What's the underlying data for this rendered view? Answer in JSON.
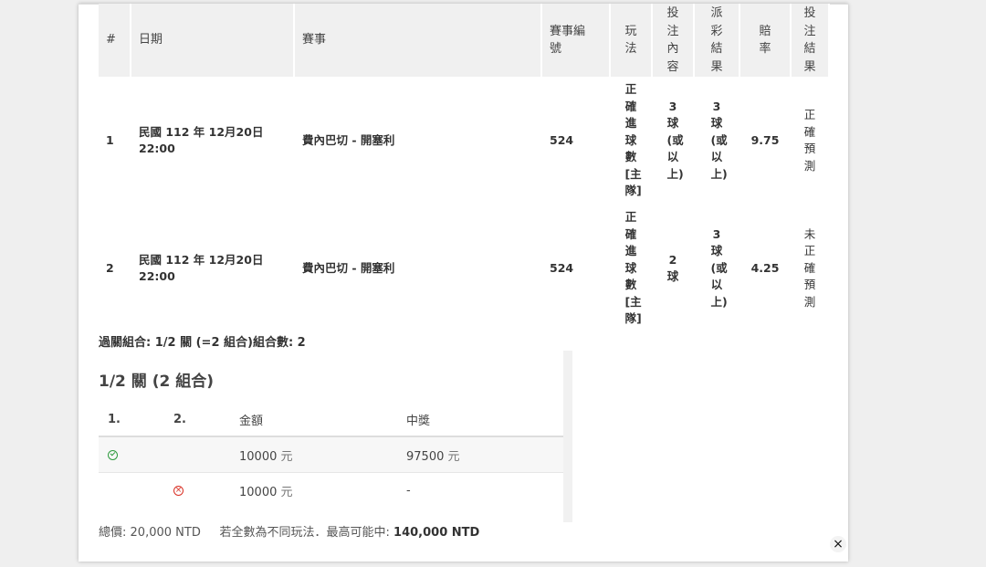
{
  "bets_table": {
    "headers": {
      "num": "#",
      "date": "日期",
      "event": "賽事",
      "event_no": "賽事編號",
      "play": "玩法",
      "selection": "投注內容",
      "result": "派彩結果",
      "odds": "賠率",
      "bet_result": "投注結果"
    },
    "rows": [
      {
        "num": "1",
        "date": "民國 112 年 12月20日",
        "time": "22:00",
        "event": "費內巴切 - 開塞利",
        "event_no": "524",
        "play": "正確進球數[主隊]",
        "selection": "3球(或以上)",
        "result": "3球(或以上)",
        "odds": "9.75",
        "bet_result": "正確預測"
      },
      {
        "num": "2",
        "date": "民國 112 年 12月20日",
        "time": "22:00",
        "event": "費內巴切 - 開塞利",
        "event_no": "524",
        "play": "正確進球數[主隊]",
        "selection": "2球",
        "result": "3球(或以上)",
        "odds": "4.25",
        "bet_result": "未正確預測"
      }
    ]
  },
  "combo_summary": "過關組合: 1/2 關 (=2 組合)組合數: 2",
  "section_title": "1/2 關 (2 組合)",
  "combos_table": {
    "headers": {
      "c1": "1.",
      "c2": "2.",
      "amount": "金額",
      "prize": "中獎"
    },
    "rows": [
      {
        "amount": "10000",
        "unit": "元",
        "prize": "97500",
        "prize_unit": "元",
        "c1_icon": "check-circle-icon",
        "c2_icon": ""
      },
      {
        "amount": "10000",
        "unit": "元",
        "prize": "-",
        "prize_unit": "",
        "c1_icon": "",
        "c2_icon": "x-circle-icon"
      }
    ]
  },
  "footer": {
    "total_label": "總價:",
    "total_value": "20,000 NTD",
    "max_label": "若全數為不同玩法．最高可能中:",
    "max_value": "140,000 NTD"
  },
  "close_symbol": "×",
  "colors": {
    "success": "#2e9b3e",
    "error": "#d93025",
    "header_bg": "#f0f0f0"
  }
}
